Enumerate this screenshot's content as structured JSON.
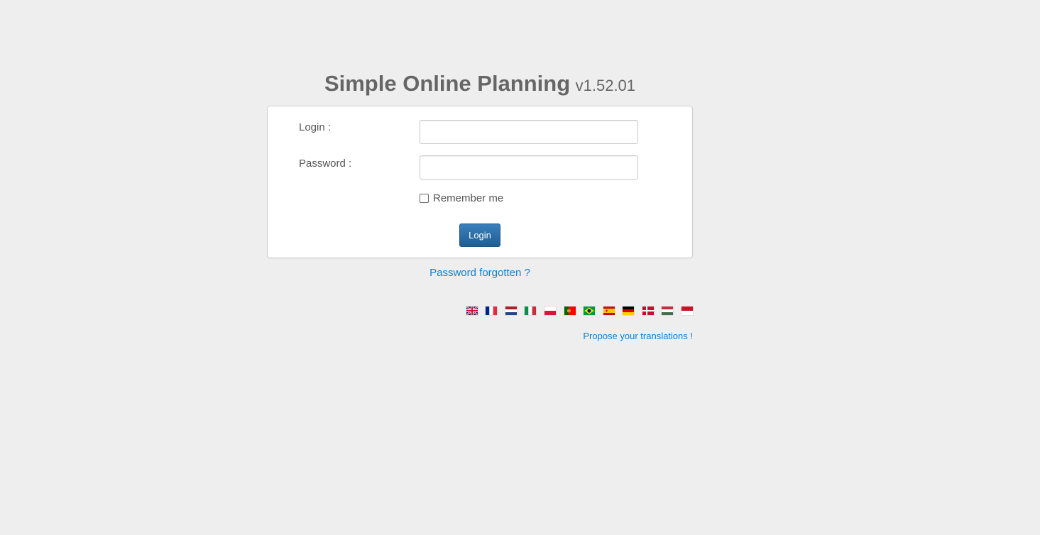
{
  "header": {
    "title": "Simple Online Planning",
    "version": "v1.52.01"
  },
  "form": {
    "login_label": "Login :",
    "login_value": "",
    "password_label": "Password :",
    "password_value": "",
    "remember_label": "Remember me",
    "remember_checked": false,
    "submit_label": "Login"
  },
  "links": {
    "forgot_password": "Password forgotten ?",
    "propose_translations": "Propose your translations !"
  },
  "languages": [
    {
      "icon": "uk-flag-icon"
    },
    {
      "icon": "france-flag-icon"
    },
    {
      "icon": "netherlands-flag-icon"
    },
    {
      "icon": "italy-flag-icon"
    },
    {
      "icon": "poland-flag-icon"
    },
    {
      "icon": "portugal-flag-icon"
    },
    {
      "icon": "brazil-flag-icon"
    },
    {
      "icon": "spain-flag-icon"
    },
    {
      "icon": "germany-flag-icon"
    },
    {
      "icon": "denmark-flag-icon"
    },
    {
      "icon": "hungary-flag-icon"
    },
    {
      "icon": "indonesia-flag-icon"
    }
  ],
  "colors": {
    "accent": "#0a7fd6",
    "button": "#2a6da8",
    "background": "#eeeeee"
  }
}
